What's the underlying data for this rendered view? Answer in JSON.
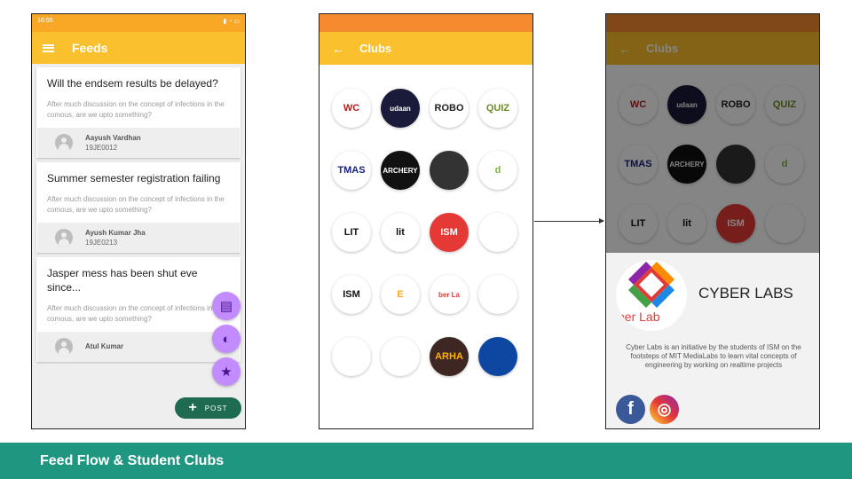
{
  "phone1": {
    "status_time": "16:55",
    "title": "Feeds",
    "posts": [
      {
        "title": "Will the endsem results be delayed?",
        "excerpt": "After much discussion on the concept of infections in the comous, are we upto something?",
        "author": "Aayush  Vardhan",
        "author_id": "19JE0012"
      },
      {
        "title": "Summer semester registration failing",
        "excerpt": "After much discussion on the concept of infections in the comous, are we upto something?",
        "author": "Ayush Kumar Jha",
        "author_id": "19JE0213"
      },
      {
        "title": "Jasper mess has been shut eve since...",
        "excerpt": "After much discussion on the concept of infections in the comous, are we upto something?",
        "author": "Atul Kumar",
        "author_id": ""
      }
    ],
    "post_button": "POST"
  },
  "phone2": {
    "title": "Clubs",
    "clubs": [
      {
        "text": "WC",
        "bg": "#ffffff",
        "fg": "#b71c1c"
      },
      {
        "text": "udaan",
        "bg": "#1a1a3a",
        "fg": "#ffffff"
      },
      {
        "text": "ROBO",
        "bg": "#ffffff",
        "fg": "#222222"
      },
      {
        "text": "QUIZ",
        "bg": "#ffffff",
        "fg": "#6b8e23"
      },
      {
        "text": "TMAS",
        "bg": "#ffffff",
        "fg": "#1a237e"
      },
      {
        "text": "ARCHERY",
        "bg": "#111111",
        "fg": "#ffffff"
      },
      {
        "text": "",
        "bg": "#333333",
        "fg": "#c62828"
      },
      {
        "text": "d",
        "bg": "#ffffff",
        "fg": "#7cb342"
      },
      {
        "text": "LIT",
        "bg": "#ffffff",
        "fg": "#111111"
      },
      {
        "text": "lit",
        "bg": "#ffffff",
        "fg": "#111111"
      },
      {
        "text": "ISM",
        "bg": "#e53935",
        "fg": "#ffffff"
      },
      {
        "text": "",
        "bg": "#ffffff",
        "fg": "#f57c00"
      },
      {
        "text": "ISM",
        "bg": "#ffffff",
        "fg": "#111111"
      },
      {
        "text": "E",
        "bg": "#ffffff",
        "fg": "#f9a825"
      },
      {
        "text": "ber La",
        "bg": "#ffffff",
        "fg": "#e53935"
      },
      {
        "text": "",
        "bg": "#ffffff",
        "fg": "#111111"
      },
      {
        "text": "",
        "bg": "#ffffff",
        "fg": "#1565c0"
      },
      {
        "text": "",
        "bg": "#ffffff",
        "fg": "#b71c1c"
      },
      {
        "text": "ARHA",
        "bg": "#3e2723",
        "fg": "#ffb300"
      },
      {
        "text": "",
        "bg": "#0d47a1",
        "fg": "#ffffff"
      }
    ]
  },
  "phone3": {
    "title": "Clubs",
    "club_name": "CYBER LABS",
    "logo_caption": "ber Lab",
    "description": "Cyber Labs is an initiative by the students of ISM on the footsteps of MIT MediaLabs to learn vital concepts of engineering by working on realtime projects",
    "facebook_glyph": "f",
    "instagram_glyph": "◎"
  },
  "footer": {
    "caption": "Feed Flow & Student Clubs"
  }
}
